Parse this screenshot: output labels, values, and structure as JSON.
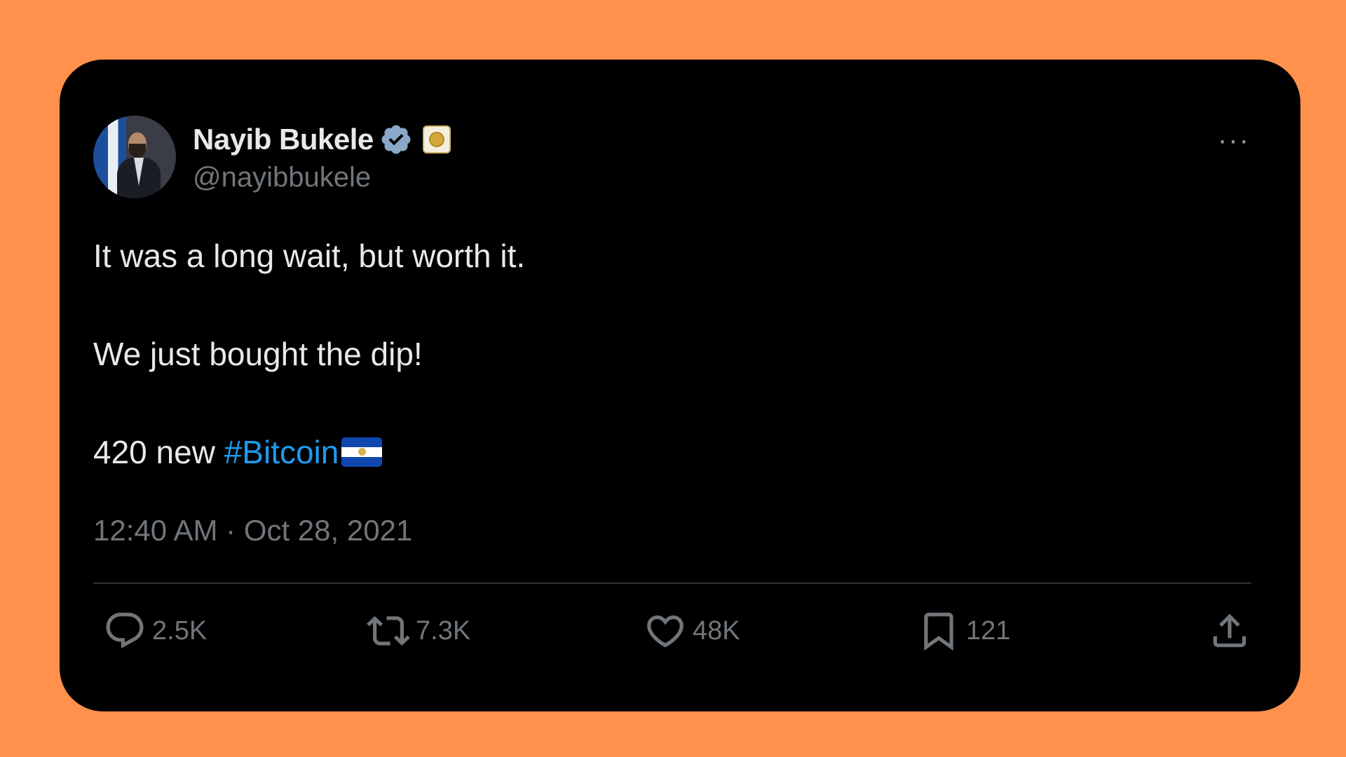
{
  "author": {
    "name": "Nayib Bukele",
    "handle": "@nayibbukele",
    "avatar_icon": "profile-photo",
    "verified_icon": "verified-badge-icon",
    "affiliate_icon": "government-seal-icon"
  },
  "tweet": {
    "line1": "It was a long wait, but worth it.",
    "line2": "We just bought the dip!",
    "line3_prefix": "420 new ",
    "hashtag": "#Bitcoin",
    "flag_icon": "el-salvador-flag-emoji",
    "timestamp": "12:40 AM · Oct 28, 2021"
  },
  "menu": {
    "more_label": "···"
  },
  "actions": {
    "replies": "2.5K",
    "reposts": "7.3K",
    "likes": "48K",
    "bookmarks": "121"
  },
  "colors": {
    "background": "#FF914D",
    "card": "#000000",
    "text_primary": "#E7E9EA",
    "text_secondary": "#71767B",
    "link": "#1D9BF0",
    "verified": "#8AA8C8"
  }
}
